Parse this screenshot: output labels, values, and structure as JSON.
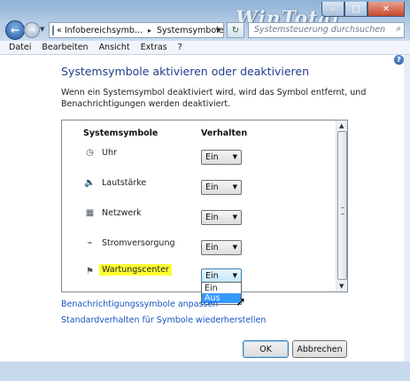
{
  "window": {
    "watermark": "WinTotal",
    "caption_minimize": "–",
    "caption_maximize": "□",
    "caption_close": "✕"
  },
  "nav": {
    "back_icon": "back-arrow-icon",
    "forward_icon": "forward-arrow-icon"
  },
  "address": {
    "prefix": "«",
    "crumb1": "Infobereichsymb...",
    "sep": "▸",
    "crumb2": "Systemsymbole"
  },
  "search": {
    "placeholder": "Systemsteuerung durchsuchen"
  },
  "menu": {
    "items": [
      "Datei",
      "Bearbeiten",
      "Ansicht",
      "Extras",
      "?"
    ]
  },
  "page": {
    "title": "Systemsymbole aktivieren oder deaktivieren",
    "description": "Wenn ein Systemsymbol deaktiviert wird, wird das Symbol entfernt, und Benachrichtigungen werden deaktiviert."
  },
  "table": {
    "col_symbols": "Systemsymbole",
    "col_behavior": "Verhalten",
    "rows": [
      {
        "label": "Uhr",
        "value": "Ein",
        "icon": "clock-icon"
      },
      {
        "label": "Lautstärke",
        "value": "Ein",
        "icon": "speaker-icon"
      },
      {
        "label": "Netzwerk",
        "value": "Ein",
        "icon": "network-icon"
      },
      {
        "label": "Stromversorgung",
        "value": "Ein",
        "icon": "power-plug-icon"
      },
      {
        "label": "Wartungscenter",
        "value": "Ein",
        "icon": "flag-icon"
      }
    ],
    "dropdown_options": [
      "Ein",
      "Aus"
    ]
  },
  "links": {
    "customize": "Benachrichtigungssymbole anpassen",
    "restore": "Standardverhalten für Symbole wiederherstellen"
  },
  "buttons": {
    "ok": "OK",
    "cancel": "Abbrechen"
  },
  "colors": {
    "title_blue": "#1e3f8a",
    "link_blue": "#1a55c0",
    "highlight": "#ffff33",
    "hover": "#3399ff"
  }
}
